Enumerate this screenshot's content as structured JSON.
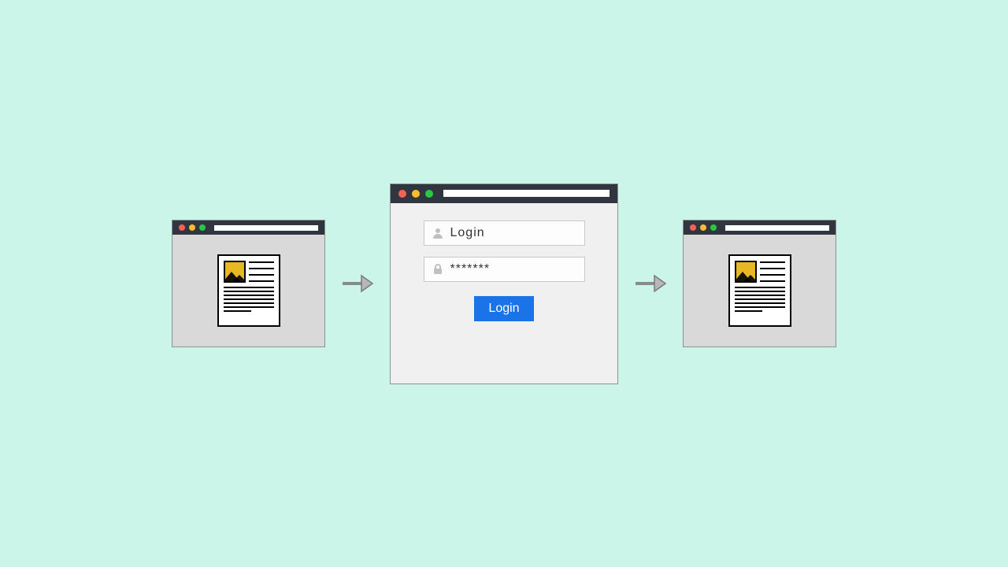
{
  "diagram": {
    "description": "Login flow diagram: content window → login window → content window",
    "colors": {
      "background": "#caf5e8",
      "titlebar": "#2f3640",
      "button": "#1a73e8",
      "doc_image": "#e8b823"
    }
  },
  "login": {
    "username_placeholder": "Login",
    "password_value": "*******",
    "button_label": "Login"
  }
}
